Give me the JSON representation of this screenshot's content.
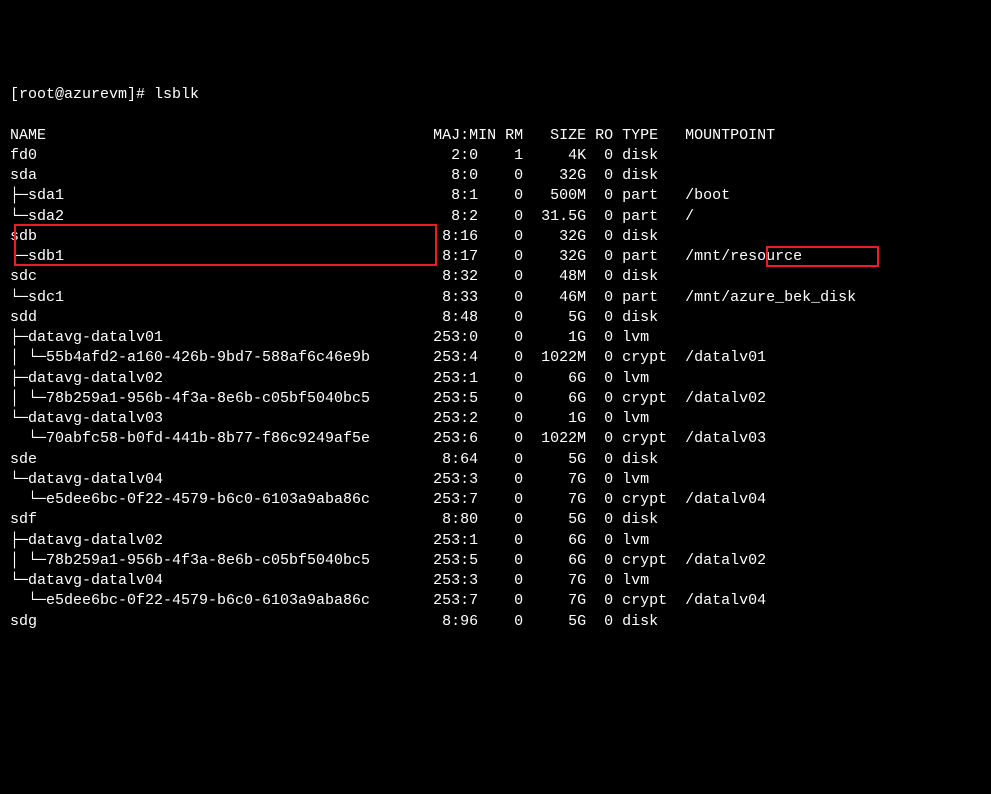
{
  "prompt": "[root@azurevm]#",
  "command": " lsblk",
  "header": {
    "name": "NAME",
    "majmin": "MAJ:MIN",
    "rm": "RM",
    "size": "SIZE",
    "ro": "RO",
    "type": "TYPE",
    "mountpoint": "MOUNTPOINT"
  },
  "rows": [
    {
      "name": "fd0",
      "majmin": "2:0",
      "rm": "1",
      "size": "4K",
      "ro": "0",
      "type": "disk",
      "mountpoint": ""
    },
    {
      "name": "sda",
      "majmin": "8:0",
      "rm": "0",
      "size": "32G",
      "ro": "0",
      "type": "disk",
      "mountpoint": ""
    },
    {
      "name": "├─sda1",
      "majmin": "8:1",
      "rm": "0",
      "size": "500M",
      "ro": "0",
      "type": "part",
      "mountpoint": "/boot"
    },
    {
      "name": "└─sda2",
      "majmin": "8:2",
      "rm": "0",
      "size": "31.5G",
      "ro": "0",
      "type": "part",
      "mountpoint": "/"
    },
    {
      "name": "sdb",
      "majmin": "8:16",
      "rm": "0",
      "size": "32G",
      "ro": "0",
      "type": "disk",
      "mountpoint": ""
    },
    {
      "name": "└─sdb1",
      "majmin": "8:17",
      "rm": "0",
      "size": "32G",
      "ro": "0",
      "type": "part",
      "mountpoint": "/mnt/resource"
    },
    {
      "name": "sdc",
      "majmin": "8:32",
      "rm": "0",
      "size": "48M",
      "ro": "0",
      "type": "disk",
      "mountpoint": ""
    },
    {
      "name": "└─sdc1",
      "majmin": "8:33",
      "rm": "0",
      "size": "46M",
      "ro": "0",
      "type": "part",
      "mountpoint": "/mnt/azure_bek_disk"
    },
    {
      "name": "sdd",
      "majmin": "8:48",
      "rm": "0",
      "size": "5G",
      "ro": "0",
      "type": "disk",
      "mountpoint": ""
    },
    {
      "name": "├─datavg-datalv01",
      "majmin": "253:0",
      "rm": "0",
      "size": "1G",
      "ro": "0",
      "type": "lvm",
      "mountpoint": ""
    },
    {
      "name": "│ └─55b4afd2-a160-426b-9bd7-588af6c46e9b",
      "majmin": "253:4",
      "rm": "0",
      "size": "1022M",
      "ro": "0",
      "type": "crypt",
      "mountpoint": "/datalv01"
    },
    {
      "name": "├─datavg-datalv02",
      "majmin": "253:1",
      "rm": "0",
      "size": "6G",
      "ro": "0",
      "type": "lvm",
      "mountpoint": ""
    },
    {
      "name": "│ └─78b259a1-956b-4f3a-8e6b-c05bf5040bc5",
      "majmin": "253:5",
      "rm": "0",
      "size": "6G",
      "ro": "0",
      "type": "crypt",
      "mountpoint": "/datalv02"
    },
    {
      "name": "└─datavg-datalv03",
      "majmin": "253:2",
      "rm": "0",
      "size": "1G",
      "ro": "0",
      "type": "lvm",
      "mountpoint": ""
    },
    {
      "name": "  └─70abfc58-b0fd-441b-8b77-f86c9249af5e",
      "majmin": "253:6",
      "rm": "0",
      "size": "1022M",
      "ro": "0",
      "type": "crypt",
      "mountpoint": "/datalv03"
    },
    {
      "name": "sde",
      "majmin": "8:64",
      "rm": "0",
      "size": "5G",
      "ro": "0",
      "type": "disk",
      "mountpoint": ""
    },
    {
      "name": "└─datavg-datalv04",
      "majmin": "253:3",
      "rm": "0",
      "size": "7G",
      "ro": "0",
      "type": "lvm",
      "mountpoint": ""
    },
    {
      "name": "  └─e5dee6bc-0f22-4579-b6c0-6103a9aba86c",
      "majmin": "253:7",
      "rm": "0",
      "size": "7G",
      "ro": "0",
      "type": "crypt",
      "mountpoint": "/datalv04"
    },
    {
      "name": "sdf",
      "majmin": "8:80",
      "rm": "0",
      "size": "5G",
      "ro": "0",
      "type": "disk",
      "mountpoint": ""
    },
    {
      "name": "├─datavg-datalv02",
      "majmin": "253:1",
      "rm": "0",
      "size": "6G",
      "ro": "0",
      "type": "lvm",
      "mountpoint": ""
    },
    {
      "name": "│ └─78b259a1-956b-4f3a-8e6b-c05bf5040bc5",
      "majmin": "253:5",
      "rm": "0",
      "size": "6G",
      "ro": "0",
      "type": "crypt",
      "mountpoint": "/datalv02"
    },
    {
      "name": "└─datavg-datalv04",
      "majmin": "253:3",
      "rm": "0",
      "size": "7G",
      "ro": "0",
      "type": "lvm",
      "mountpoint": ""
    },
    {
      "name": "  └─e5dee6bc-0f22-4579-b6c0-6103a9aba86c",
      "majmin": "253:7",
      "rm": "0",
      "size": "7G",
      "ro": "0",
      "type": "crypt",
      "mountpoint": "/datalv04"
    },
    {
      "name": "sdg",
      "majmin": "8:96",
      "rm": "0",
      "size": "5G",
      "ro": "0",
      "type": "disk",
      "mountpoint": ""
    }
  ]
}
